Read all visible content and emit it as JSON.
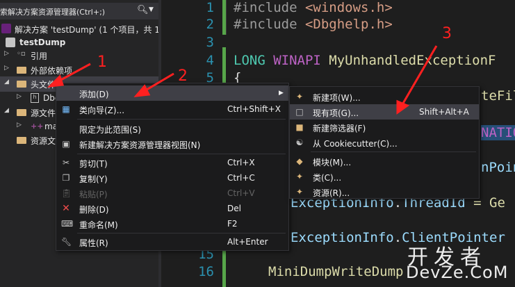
{
  "solution_explorer": {
    "search_text": "索解决方案资源管理器(Ctrl+;)",
    "root_label": "解决方案 'testDump' (1 个项目，共 1 个",
    "project_label": "testDump",
    "items": [
      {
        "label": "引用"
      },
      {
        "label": "外部依赖项"
      },
      {
        "label": "头文件"
      },
      {
        "label": "Dbg"
      },
      {
        "label": "源文件"
      },
      {
        "label": "ma"
      },
      {
        "label": "资源文"
      }
    ]
  },
  "editor": {
    "line_numbers": [
      "1",
      "2",
      "3",
      "4",
      "5",
      "15",
      "16"
    ],
    "lines": {
      "l1": {
        "pp": "#include ",
        "str": "<windows.h>"
      },
      "l2": {
        "pp": "#include ",
        "str": "<Dbghelp.h>"
      },
      "l4": {
        "ty": "LONG ",
        "macro": "WINAPI ",
        "fn": "MyUnhandledExceptionF"
      },
      "l5": "{",
      "frag_a": "teFil",
      "frag_b": "NATIO",
      "frag_c": "nPoin",
      "frag_d": {
        "id": "ExceptionInfo",
        "dot": ".",
        "id2": "ThreadId",
        "rest": " = Ge"
      },
      "frag_e": {
        "id": "ExceptionInfo",
        "dot": ".",
        "id2": "ClientPointer"
      },
      "l16": {
        "fn": "MiniDumpWriteDump"
      }
    }
  },
  "context_menu": {
    "items": [
      {
        "label": "添加(D)",
        "shortcut": "",
        "icon": "none"
      },
      {
        "label": "类向导(Z)...",
        "shortcut": "Ctrl+Shift+X",
        "icon": "class-wizard-icon"
      },
      {
        "label": "限定为此范围(S)",
        "shortcut": "",
        "icon": "none"
      },
      {
        "label": "新建解决方案资源管理器视图(N)",
        "shortcut": "",
        "icon": "new-view-icon"
      },
      {
        "label": "剪切(T)",
        "shortcut": "Ctrl+X",
        "icon": "cut-icon"
      },
      {
        "label": "复制(Y)",
        "shortcut": "Ctrl+C",
        "icon": "copy-icon"
      },
      {
        "label": "粘贴(P)",
        "shortcut": "Ctrl+V",
        "icon": "paste-icon"
      },
      {
        "label": "删除(D)",
        "shortcut": "Del",
        "icon": "delete-icon"
      },
      {
        "label": "重命名(M)",
        "shortcut": "F2",
        "icon": "rename-icon"
      },
      {
        "label": "属性(R)",
        "shortcut": "Alt+Enter",
        "icon": "properties-icon"
      }
    ]
  },
  "submenu": {
    "items": [
      {
        "label": "新建项(W)...",
        "shortcut": ""
      },
      {
        "label": "现有项(G)...",
        "shortcut": "Shift+Alt+A"
      },
      {
        "label": "新建筛选器(F)",
        "shortcut": ""
      },
      {
        "label": "从 Cookiecutter(C)...",
        "shortcut": ""
      },
      {
        "label": "模块(M)...",
        "shortcut": ""
      },
      {
        "label": "类(C)...",
        "shortcut": ""
      },
      {
        "label": "资源(R)...",
        "shortcut": ""
      }
    ]
  },
  "annotations": {
    "n1": "1",
    "n2": "2",
    "n3": "3"
  },
  "watermark": {
    "line1": "开发者",
    "line2": "DevZe.CoM"
  },
  "colors": {
    "accent_red": "#ff2020",
    "line_number": "#2b91af",
    "keyword": "#569cd6",
    "string": "#d69d85",
    "function": "#dcdcaa"
  }
}
